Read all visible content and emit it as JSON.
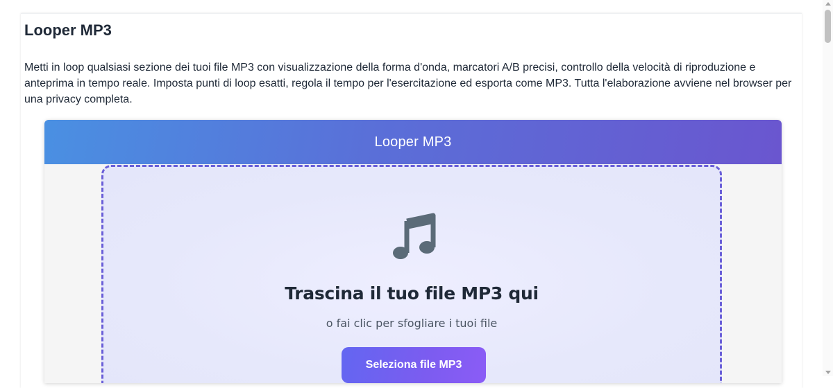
{
  "page": {
    "title": "Looper MP3",
    "description": "Metti in loop qualsiasi sezione dei tuoi file MP3 con visualizzazione della forma d'onda, marcatori A/B precisi, controllo della velocità di riproduzione e anteprima in tempo reale. Imposta punti di loop esatti, regola il tempo per l'esercitazione ed esporta come MP3. Tutta l'elaborazione avviene nel browser per una privacy completa."
  },
  "app": {
    "header_title": "Looper MP3",
    "header_gradient": [
      "#4a90e2",
      "#6a56cf"
    ],
    "drop_zone": {
      "icon": "music-note-icon",
      "title": "Trascina il tuo file MP3 qui",
      "subtitle": "o fai clic per sfogliare i tuoi file",
      "button_label": "Seleziona file MP3",
      "border_color": "#6a5fd8",
      "button_color": "#6366f1"
    }
  }
}
